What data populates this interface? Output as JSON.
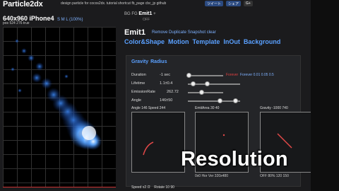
{
  "header": {
    "logo": "Particle2dx",
    "tagline": "design particle for cocos2dx. tutorial shortcut fb_page cbc_jp github",
    "social": [
      "ツイート",
      "シェア",
      "G+"
    ]
  },
  "canvas": {
    "title": "640x960 iPhone4",
    "flip": "S M L (100%)",
    "pos": "pos 524 276 true"
  },
  "toolbar": {
    "bg_fg": "BG FG",
    "emit": "Emit1",
    "plus": "+",
    "off": "OFF"
  },
  "emitter": {
    "title": "Emit1",
    "remove": "Remove Duplicate Snapshot clear"
  },
  "tabs": [
    "Color&Shape",
    "Motion",
    "Template",
    "InOut",
    "Background"
  ],
  "section_tabs": [
    "Gravity",
    "Radius"
  ],
  "rows": [
    {
      "label": "Duration",
      "value": "-1 sec",
      "forever": "Forever",
      "opts": "Forever 0.01 0.05 0.5"
    },
    {
      "label": "Lifetime",
      "value": "1.1±0.4"
    },
    {
      "label": "EmissionRate",
      "value": "262.72"
    },
    {
      "label": "Angle",
      "value": "146±50"
    }
  ],
  "minis": [
    {
      "label": "Angle 146 Speed 244",
      "foot": "0x0 Hor Ver 320x480"
    },
    {
      "label": "EmitArea 30 40",
      "foot": ""
    },
    {
      "label": "Gravity -1000 740",
      "foot": "OFF 80% 120 150"
    }
  ],
  "bottom": {
    "speed": "Speed x2 /2",
    "rotate": "Rotate 10 90"
  },
  "overlay": "Resolution"
}
